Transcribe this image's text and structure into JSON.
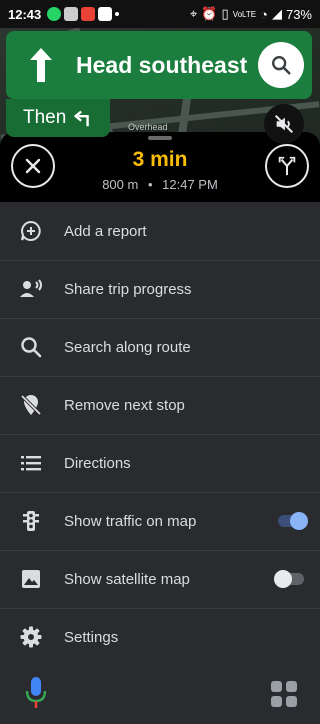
{
  "status_bar": {
    "time": "12:43",
    "battery": "73%"
  },
  "navigation": {
    "instruction": "Head southeast",
    "next_label": "Then",
    "map_label": "Overhead"
  },
  "trip": {
    "eta": "3 min",
    "distance": "800 m",
    "separator": "•",
    "arrival": "12:47 PM"
  },
  "menu": {
    "add_report": "Add a report",
    "share_trip": "Share trip progress",
    "search_route": "Search along route",
    "remove_stop": "Remove next stop",
    "directions": "Directions",
    "traffic": "Show traffic on map",
    "satellite": "Show satellite map",
    "settings": "Settings"
  },
  "toggles": {
    "traffic_on": true,
    "satellite_on": false
  },
  "colors": {
    "nav_green": "#1b7e3e",
    "eta_yellow": "#fbbc04",
    "toggle_blue": "#8ab4f8",
    "highlight_red": "#e00000"
  },
  "icons": {
    "instruction": "arrow-up-icon",
    "next_turn": "turn-left-icon",
    "search": "search-icon",
    "mute": "volume-off-icon",
    "close": "close-icon",
    "route": "route-options-icon",
    "report": "add-report-icon",
    "share": "share-person-icon",
    "search_route": "search-icon",
    "remove_stop": "remove-stop-icon",
    "directions": "list-icon",
    "traffic": "traffic-light-icon",
    "satellite": "image-icon",
    "settings": "gear-icon",
    "mic": "mic-icon",
    "apps": "apps-grid-icon"
  }
}
